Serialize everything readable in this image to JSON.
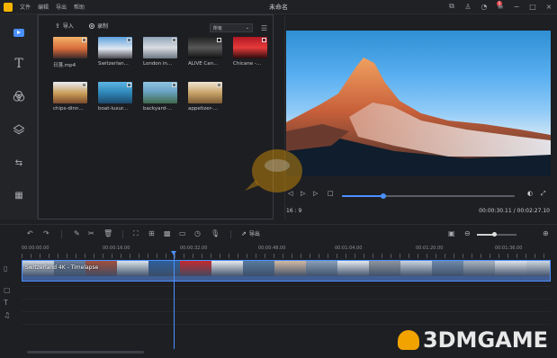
{
  "window": {
    "title": "未命名",
    "menu": [
      "文件",
      "编辑",
      "导出",
      "帮助"
    ],
    "notification_count": "5"
  },
  "media": {
    "import_label": "导入",
    "record_label": "录制",
    "filter_value": "所有",
    "items": [
      {
        "label": "日落.mp4",
        "thumb": "sunset"
      },
      {
        "label": "Switzerlan...",
        "thumb": "mountain"
      },
      {
        "label": "London in...",
        "thumb": "london"
      },
      {
        "label": "ALIVE  Can...",
        "thumb": "alive"
      },
      {
        "label": "Chicane -...",
        "thumb": "chicane"
      },
      {
        "label": "chips-dinn...",
        "thumb": "chips"
      },
      {
        "label": "boat-luxur...",
        "thumb": "boat"
      },
      {
        "label": "backyard-...",
        "thumb": "backyard"
      },
      {
        "label": "appetizer-...",
        "thumb": "appetizer"
      }
    ]
  },
  "player": {
    "ratio": "16 : 9",
    "time": "00:00:30.11 / 00:02:27.10",
    "progress": 0.24
  },
  "toolbar": {
    "export_label": "导出",
    "zoom_level": 0.45
  },
  "timeline": {
    "ticks": [
      "00:00:00.00",
      "00:00:16.00",
      "00:00:32.00",
      "00:00:48.00",
      "00:01:04.00",
      "00:01:20.00",
      "00:01:36.00"
    ],
    "clip_title": "Switzerland 4K - Timelapse",
    "playhead_progress": 0.205
  },
  "watermark": {
    "text": "3DMGAME"
  },
  "colors": {
    "accent": "#4a90ff",
    "background": "#1e1f23",
    "panel": "#232428"
  }
}
